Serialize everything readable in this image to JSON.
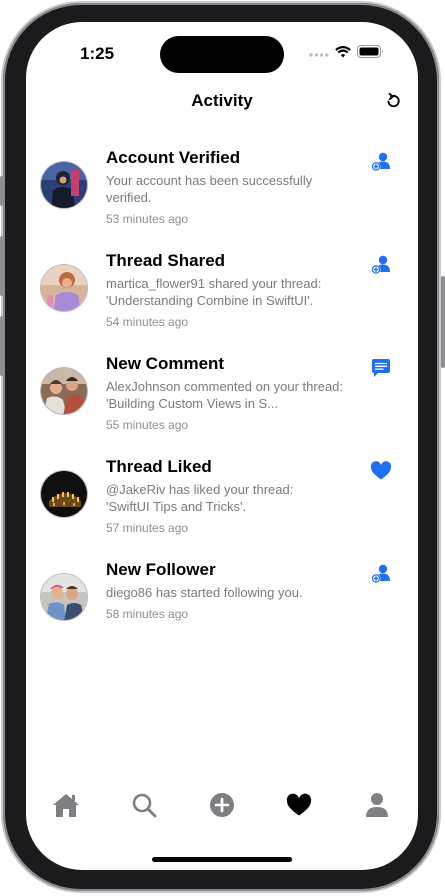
{
  "status_bar": {
    "time": "1:25",
    "icons": [
      "signal-dots-icon",
      "wifi-icon",
      "battery-icon"
    ]
  },
  "header": {
    "title": "Activity",
    "refresh_icon": "refresh-icon"
  },
  "activities": [
    {
      "title": "Account Verified",
      "description": "Your account has been successfully verified.",
      "time": "53 minutes ago",
      "icon": "person-add-icon"
    },
    {
      "title": "Thread Shared",
      "description": "martica_flower91 shared your thread: 'Understanding Combine in SwiftUI'.",
      "time": "54 minutes ago",
      "icon": "person-add-icon"
    },
    {
      "title": "New Comment",
      "description": "AlexJohnson commented on your thread: 'Building Custom Views in S...",
      "time": "55 minutes ago",
      "icon": "message-icon"
    },
    {
      "title": "Thread Liked",
      "description": "@JakeRiv has liked your thread: 'SwiftUI Tips and Tricks'.",
      "time": "57 minutes ago",
      "icon": "heart-icon"
    },
    {
      "title": "New Follower",
      "description": "diego86 has started following you.",
      "time": "58 minutes ago",
      "icon": "person-add-icon"
    }
  ],
  "tab_bar": {
    "tabs": [
      "home-icon",
      "search-icon",
      "plus-circle-icon",
      "heart-icon",
      "person-icon"
    ],
    "active_tab": "heart-icon"
  },
  "colors": {
    "accent": "#1f6ff2",
    "tab_inactive": "#7f7f83",
    "tab_active": "#000000",
    "secondary_text": "#7b7b80"
  }
}
